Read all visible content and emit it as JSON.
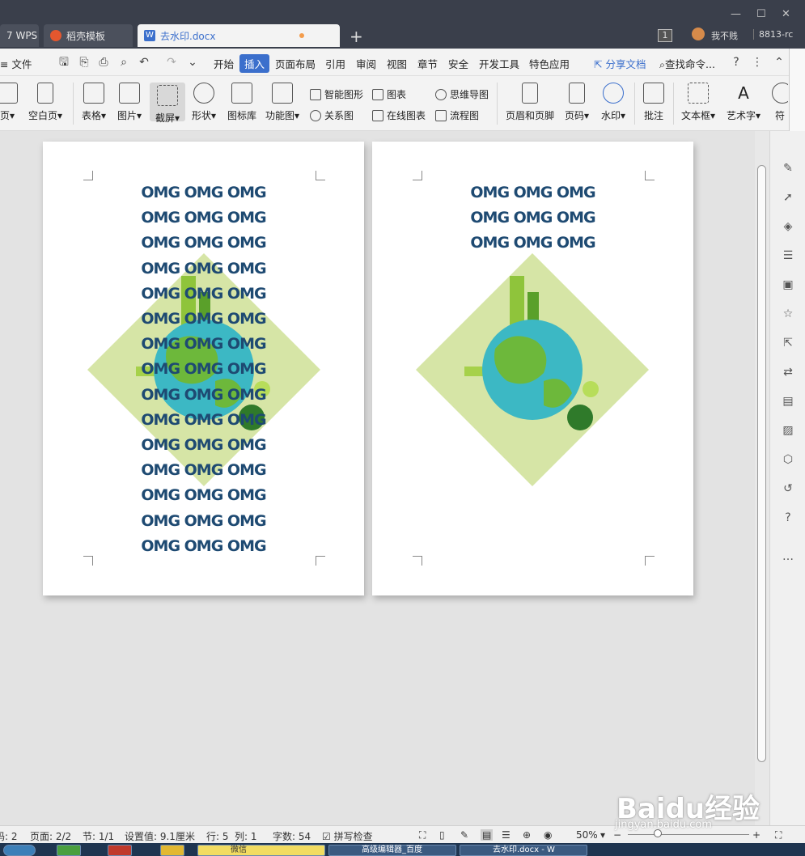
{
  "titlebar": {
    "tabs": [
      {
        "label": "7 WPS"
      },
      {
        "label": "稻壳模板"
      },
      {
        "label": "去水印.docx"
      }
    ],
    "badge": "1",
    "username": "我不贱",
    "user_id": "8813-rc"
  },
  "menubar": {
    "file_label": "文件",
    "items": [
      "开始",
      "插入",
      "页面布局",
      "引用",
      "审阅",
      "视图",
      "章节",
      "安全",
      "开发工具",
      "特色应用"
    ],
    "active": "插入",
    "share_label": "分享文档",
    "search_label": "查找命令..."
  },
  "ribbon": {
    "big_buttons": [
      "页",
      "空白页",
      "表格",
      "图片",
      "截屏",
      "形状",
      "图标库",
      "功能图",
      "页眉和页脚",
      "页码",
      "水印",
      "批注",
      "文本框",
      "艺术字",
      "符"
    ],
    "small_buttons": [
      "智能图形",
      "图表",
      "思维导图",
      "关系图",
      "在线图表",
      "流程图"
    ]
  },
  "document": {
    "watermark_text": "OMG OMG OMG",
    "page1_lines": 15,
    "page2_lines": 3
  },
  "statusbar": {
    "items": [
      "码: 2",
      "页面: 2/2",
      "节: 1/1",
      "设置值: 9.1厘米",
      "行: 5",
      "列: 1",
      "字数: 54",
      "拼写检查"
    ],
    "zoom": "50%"
  },
  "taskbar": {
    "items": [
      "微信",
      "高级编辑器_百度",
      "去水印.docx - W"
    ]
  },
  "overlay": {
    "brand": "Baidu经验",
    "url": "jingyan.baidu.com"
  },
  "colors": {
    "titlebar_bg": "#3a3f4b",
    "accent": "#3b6fcc",
    "watermark_text": "#1e4a72",
    "diamond": "#d6e5a6",
    "earth_ocean": "#3cb8c4",
    "earth_land": "#6db83b"
  }
}
